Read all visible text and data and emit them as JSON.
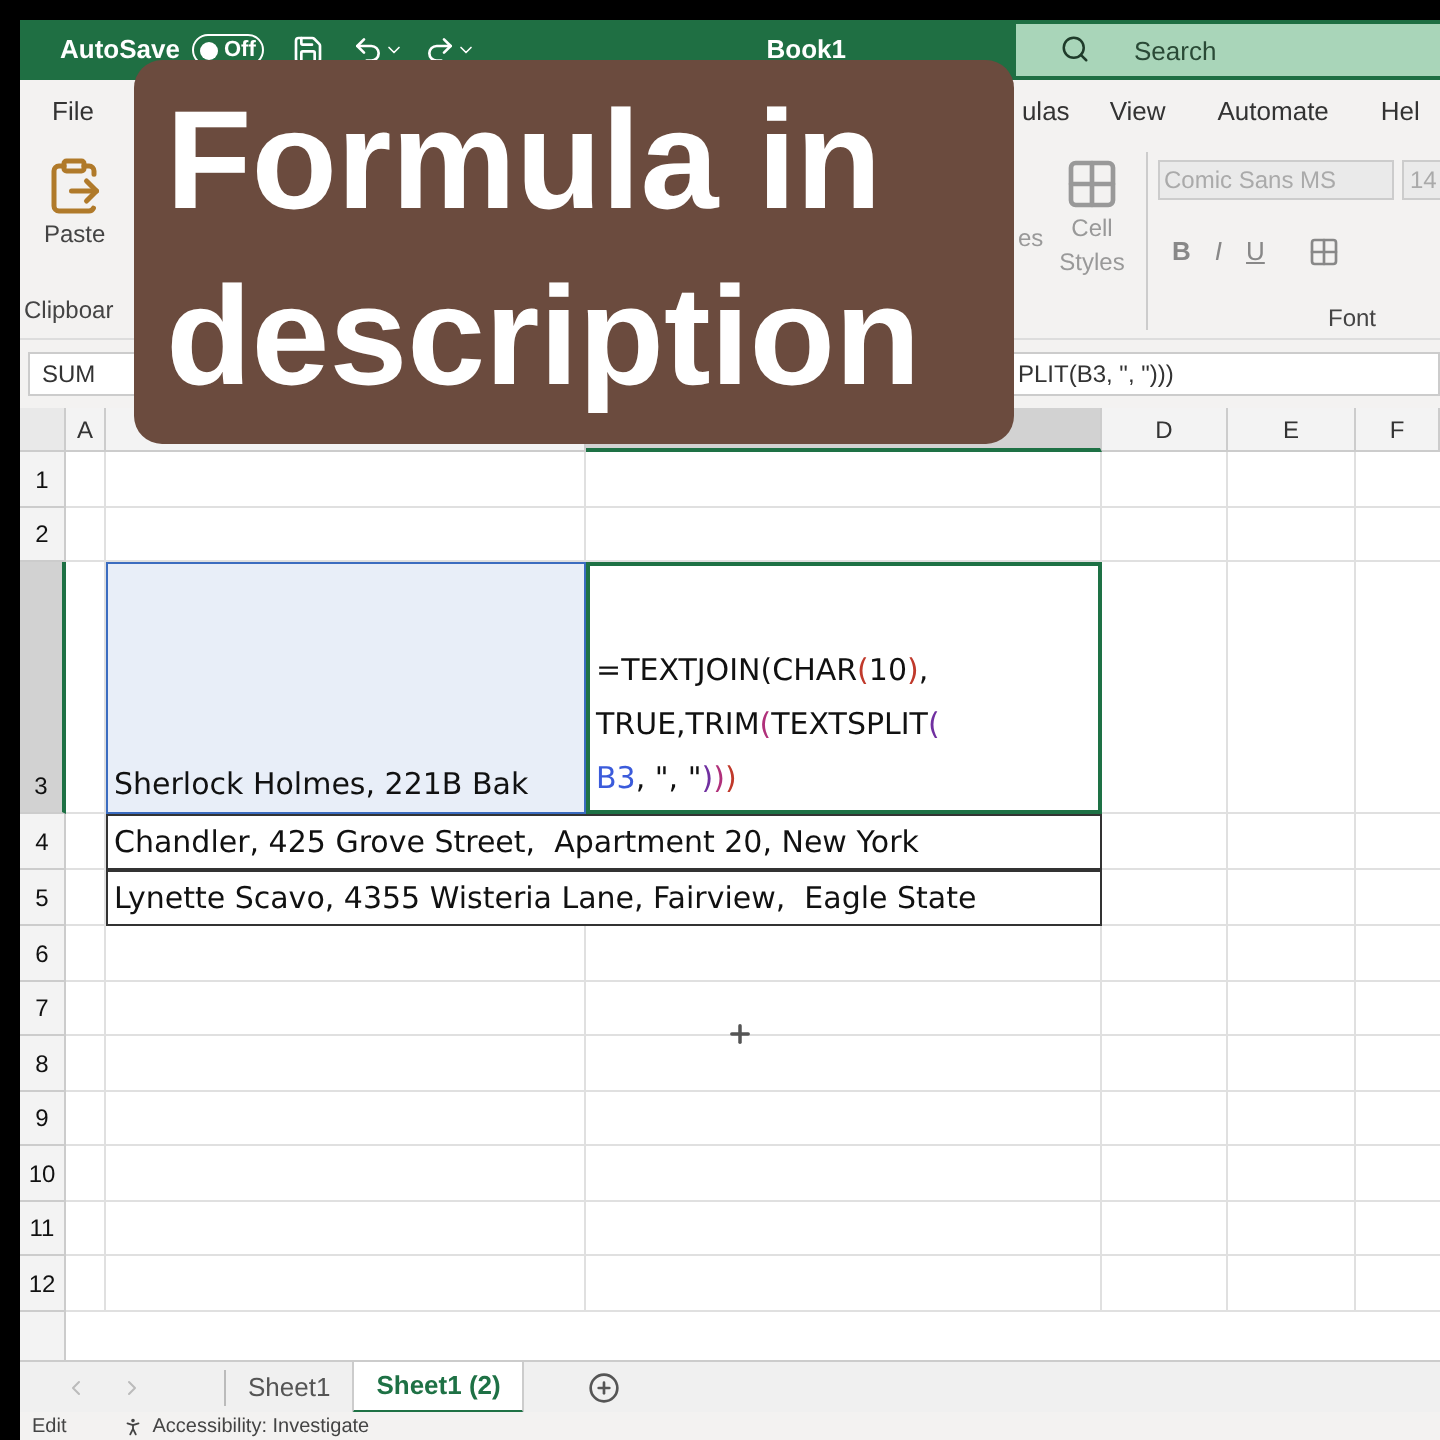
{
  "title_bar": {
    "autosave_label": "AutoSave",
    "autosave": {
      "on": false,
      "label": "Off"
    },
    "title": "Book1",
    "search": {
      "placeholder": "Search"
    }
  },
  "caption": "Formula in description",
  "ribbon_tabs": [
    {
      "label": "File"
    },
    {
      "label": "ulas"
    },
    {
      "label": "View"
    },
    {
      "label": "Automate"
    },
    {
      "label": "Hel"
    }
  ],
  "ribbon": {
    "paste": "Paste",
    "clipboard_group": "Clipboar",
    "styles_fragment": "es",
    "cell_styles": "Cell Styles",
    "font_name": "Comic Sans MS",
    "font_size": "14",
    "format_buttons": [
      "B",
      "I",
      "U"
    ],
    "font_group": "Font"
  },
  "formula_bar": {
    "name_box": "SUM",
    "formula": "PLIT(B3, \", \")))"
  },
  "columns": [
    {
      "label": "A",
      "selected": false
    },
    {
      "selected": false
    },
    {
      "selected": true
    },
    {
      "label": "D",
      "selected": false
    },
    {
      "label": "E",
      "selected": false
    },
    {
      "label": "F",
      "selected": false
    }
  ],
  "rows": [
    {
      "label": "1",
      "selected": false
    },
    {
      "label": "2",
      "selected": false
    },
    {
      "label": "3",
      "selected": true
    },
    {
      "label": "4",
      "selected": false
    },
    {
      "label": "5",
      "selected": false
    },
    {
      "label": "6",
      "selected": false
    },
    {
      "label": "7",
      "selected": false
    },
    {
      "label": "8",
      "selected": false
    },
    {
      "label": "9",
      "selected": false
    },
    {
      "label": "10",
      "selected": false
    },
    {
      "label": "11",
      "selected": false
    },
    {
      "label": "12",
      "selected": false
    }
  ],
  "cells": {
    "b3": "Sherlock Holmes, 221B Bak",
    "c3_formula": [
      [
        {
          "text": "=TEXTJOIN(CHAR",
          "color": "#111111"
        },
        {
          "text": "(",
          "color": "#c0392b"
        },
        {
          "text": "10",
          "color": "#111111"
        },
        {
          "text": ")",
          "color": "#c0392b"
        },
        {
          "text": ",",
          "color": "#111111"
        }
      ],
      [
        {
          "text": "TRUE,TRIM",
          "color": "#111111"
        },
        {
          "text": "(",
          "color": "#b0307a"
        },
        {
          "text": "TEXTSPLIT",
          "color": "#111111"
        },
        {
          "text": "(",
          "color": "#7030a0"
        }
      ],
      [
        {
          "text": "B3",
          "color": "#3b5bdb"
        },
        {
          "text": ", \", \"",
          "color": "#111111"
        },
        {
          "text": ")",
          "color": "#7030a0"
        },
        {
          "text": ")",
          "color": "#b0307a"
        },
        {
          "text": ")",
          "color": "#c0392b"
        }
      ]
    ],
    "b4": "Chandler, 425 Grove Street,  Apartment 20, New York",
    "b5": "Lynette Scavo, 4355 Wisteria Lane, Fairview,  Eagle State"
  },
  "sheet_tabs": [
    {
      "label": "Sheet1",
      "selected": false
    },
    {
      "label": "Sheet1 (2)",
      "selected": true
    }
  ],
  "status_bar": {
    "mode": "Edit",
    "accessibility": "Accessibility: Investigate"
  }
}
